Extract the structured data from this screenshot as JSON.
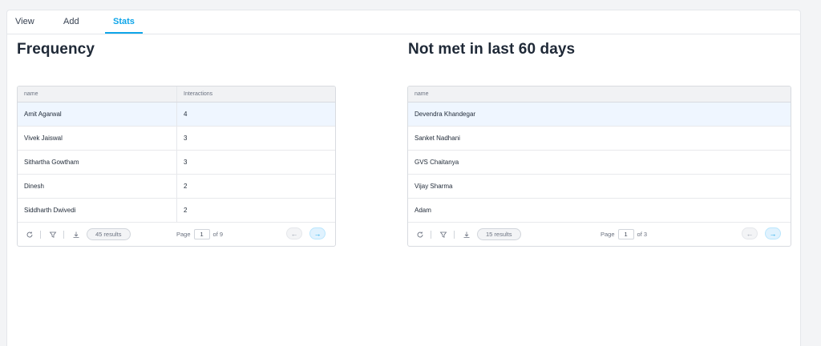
{
  "tabs": [
    {
      "label": "View"
    },
    {
      "label": "Add"
    },
    {
      "label": "Stats"
    }
  ],
  "frequency": {
    "title": "Frequency",
    "columns": [
      "name",
      "Interactions"
    ],
    "rows": [
      {
        "name": "Amit Agarwal",
        "interactions": "4"
      },
      {
        "name": "Vivek Jaiswal",
        "interactions": "3"
      },
      {
        "name": "Sithartha Gowtham",
        "interactions": "3"
      },
      {
        "name": "Dinesh",
        "interactions": "2"
      },
      {
        "name": "Siddharth Dwivedi",
        "interactions": "2"
      }
    ],
    "footer": {
      "results": "45 results",
      "page_label": "Page",
      "page_value": "1",
      "page_of": "of 9"
    }
  },
  "not_met": {
    "title": "Not met in last 60 days",
    "columns": [
      "name"
    ],
    "rows": [
      {
        "name": "Devendra Khandegar"
      },
      {
        "name": "Sanket Nadhani"
      },
      {
        "name": "GVS Chaitanya"
      },
      {
        "name": "Vijay Sharma"
      },
      {
        "name": "Adam"
      }
    ],
    "footer": {
      "results": "15 results",
      "page_label": "Page",
      "page_value": "1",
      "page_of": "of 3"
    }
  },
  "icons": {
    "refresh": "refresh-icon",
    "filter": "filter-icon",
    "download": "download-icon",
    "prev": "arrow-left-icon",
    "next": "arrow-right-icon"
  },
  "colors": {
    "accent": "#0ea5e9",
    "highlight_row": "#eff6ff"
  }
}
